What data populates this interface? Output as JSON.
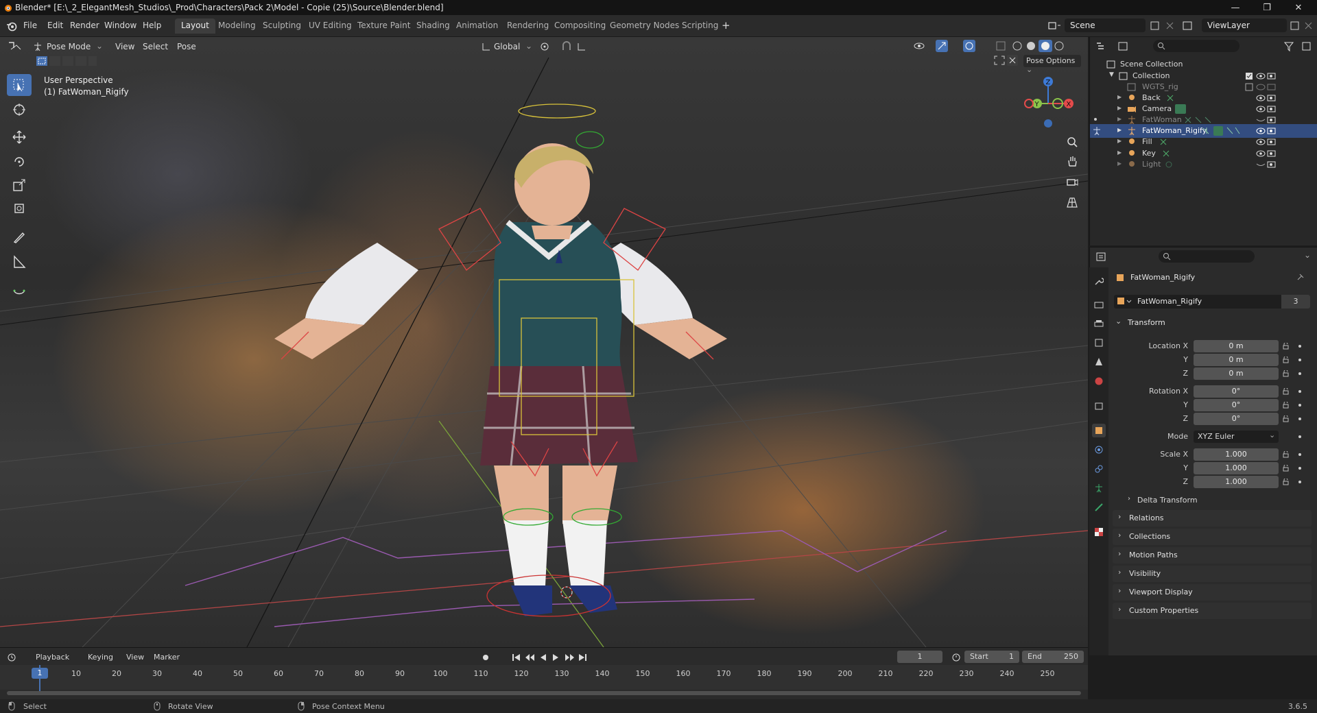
{
  "window": {
    "title": "Blender* [E:\\_2_ElegantMesh_Studios\\_Prod\\Characters\\Pack 2\\Model - Copie (25)\\Source\\Blender.blend]"
  },
  "menu": {
    "items": [
      "File",
      "Edit",
      "Render",
      "Window",
      "Help"
    ],
    "workspaces": [
      "Layout",
      "Modeling",
      "Sculpting",
      "UV Editing",
      "Texture Paint",
      "Shading",
      "Animation",
      "Rendering",
      "Compositing",
      "Geometry Nodes",
      "Scripting"
    ],
    "active_workspace": "Layout",
    "scene": "Scene",
    "view_layer": "ViewLayer"
  },
  "viewport": {
    "mode": "Pose Mode",
    "menus": [
      "View",
      "Select",
      "Pose"
    ],
    "orientation": "Global",
    "pose_options": "Pose Options",
    "overlay_line1": "User Perspective",
    "overlay_line2": "(1) FatWoman_Rigify",
    "gizmo_axes": [
      "X",
      "Y",
      "Z"
    ]
  },
  "outliner": {
    "root": "Scene Collection",
    "collection": "Collection",
    "items": [
      {
        "name": "WGTS_rig",
        "dim": true
      },
      {
        "name": "Back",
        "dim": false
      },
      {
        "name": "Camera",
        "dim": false
      },
      {
        "name": "FatWoman",
        "dim": true
      },
      {
        "name": "FatWoman_Rigify",
        "dim": false,
        "selected": true
      },
      {
        "name": "Fill",
        "dim": false
      },
      {
        "name": "Key",
        "dim": false
      },
      {
        "name": "Light",
        "dim": true
      }
    ]
  },
  "properties": {
    "object_name": "FatWoman_Rigify",
    "datablock_name": "FatWoman_Rigify",
    "datablock_users": "3",
    "transform_title": "Transform",
    "location": {
      "label": "Location X",
      "x": "0 m",
      "y": "0 m",
      "z": "0 m"
    },
    "rotation": {
      "label": "Rotation X",
      "x": "0°",
      "y": "0°",
      "z": "0°"
    },
    "mode_label": "Mode",
    "mode_value": "XYZ Euler",
    "scale": {
      "label": "Scale X",
      "x": "1.000",
      "y": "1.000",
      "z": "1.000"
    },
    "axis_y": "Y",
    "axis_z": "Z",
    "delta_transform": "Delta Transform",
    "panels": [
      "Relations",
      "Collections",
      "Motion Paths",
      "Visibility",
      "Viewport Display",
      "Custom Properties"
    ]
  },
  "timeline": {
    "menus": [
      "Playback",
      "Keying",
      "View",
      "Marker"
    ],
    "current_frame": "1",
    "start_label": "Start",
    "start": "1",
    "end_label": "End",
    "end": "250",
    "ticks": [
      "1",
      "10",
      "20",
      "30",
      "40",
      "50",
      "60",
      "70",
      "80",
      "90",
      "100",
      "110",
      "120",
      "130",
      "140",
      "150",
      "160",
      "170",
      "180",
      "190",
      "200",
      "210",
      "220",
      "230",
      "240",
      "250"
    ]
  },
  "statusbar": {
    "select": "Select",
    "rotate": "Rotate View",
    "context": "Pose Context Menu",
    "version": "3.6.5"
  },
  "colors": {
    "accent": "#4772b3",
    "selected_row": "#334d80",
    "axis_x": "#e44b4b",
    "axis_y": "#8bc34a",
    "axis_z": "#3d7ad6"
  }
}
